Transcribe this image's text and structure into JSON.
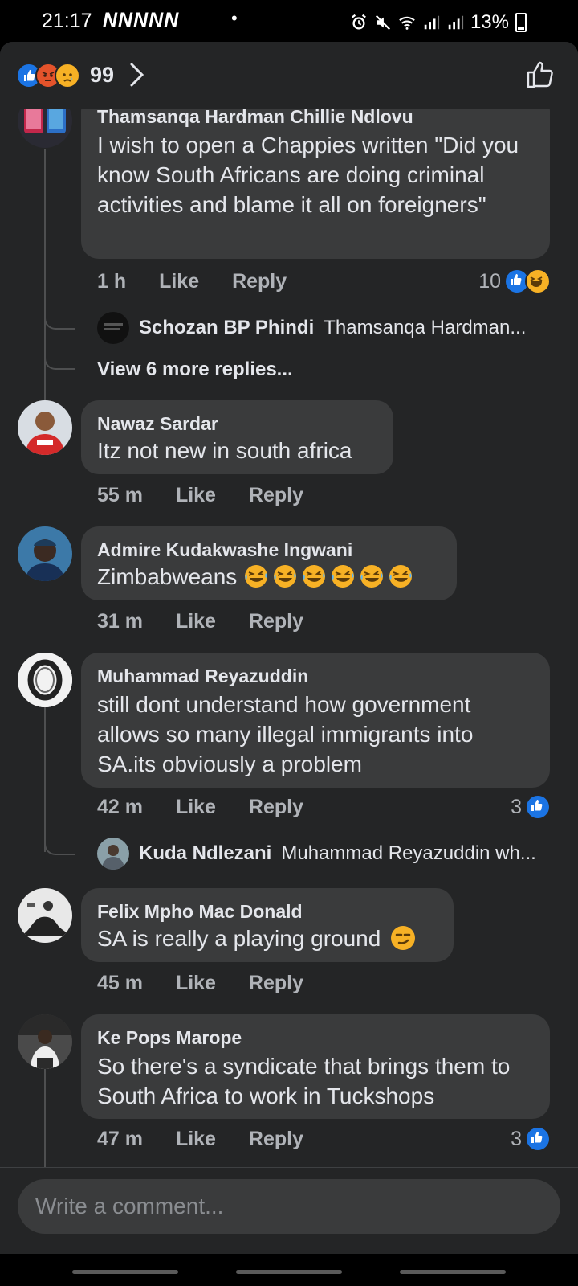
{
  "status_bar": {
    "time": "21:17",
    "notifications": "NNNNN",
    "dot": "•",
    "battery": "13%"
  },
  "reactions": {
    "count": "99",
    "types": [
      "like-icon",
      "angry-icon",
      "sad-icon"
    ]
  },
  "comments": [
    {
      "author": "Thamsanqa Hardman Chillie Ndlovu",
      "text": "I wish to open a Chappies written \"Did you know South Africans are doing criminal activities and blame it all on foreigners\"",
      "time": "1 h",
      "like": "Like",
      "reply": "Reply",
      "reaction_count": "10",
      "reply_preview": {
        "name": "Schozan BP Phindi",
        "text": "Thamsanqa Hardman..."
      },
      "more_replies": "View 6 more replies..."
    },
    {
      "author": "Nawaz Sardar",
      "text": "Itz not new in south africa",
      "time": "55 m",
      "like": "Like",
      "reply": "Reply"
    },
    {
      "author": "Admire Kudakwashe Ingwani",
      "text": "Zimbabweans",
      "laugh_emoji_count": 6,
      "time": "31 m",
      "like": "Like",
      "reply": "Reply"
    },
    {
      "author": "Muhammad Reyazuddin",
      "text": "still dont understand how government allows so many illegal immigrants into SA.its obviously a problem",
      "time": "42 m",
      "like": "Like",
      "reply": "Reply",
      "reaction_count": "3",
      "reply_preview": {
        "name": "Kuda Ndlezani",
        "text": "Muhammad Reyazuddin wh..."
      }
    },
    {
      "author": "Felix Mpho Mac Donald",
      "text": "SA is really a playing ground",
      "time": "45 m",
      "like": "Like",
      "reply": "Reply"
    },
    {
      "author": "Ke Pops Marope",
      "text": "So there's a syndicate that brings them to South Africa to work in Tuckshops",
      "time": "47 m",
      "like": "Like",
      "reply": "Reply",
      "reaction_count": "3"
    }
  ],
  "composer": {
    "placeholder": "Write a comment..."
  },
  "colors": {
    "background": "#242526",
    "bubble": "#3a3b3c",
    "text": "#e4e6eb",
    "muted": "#b0b3b8",
    "like_blue": "#1b74e4"
  }
}
